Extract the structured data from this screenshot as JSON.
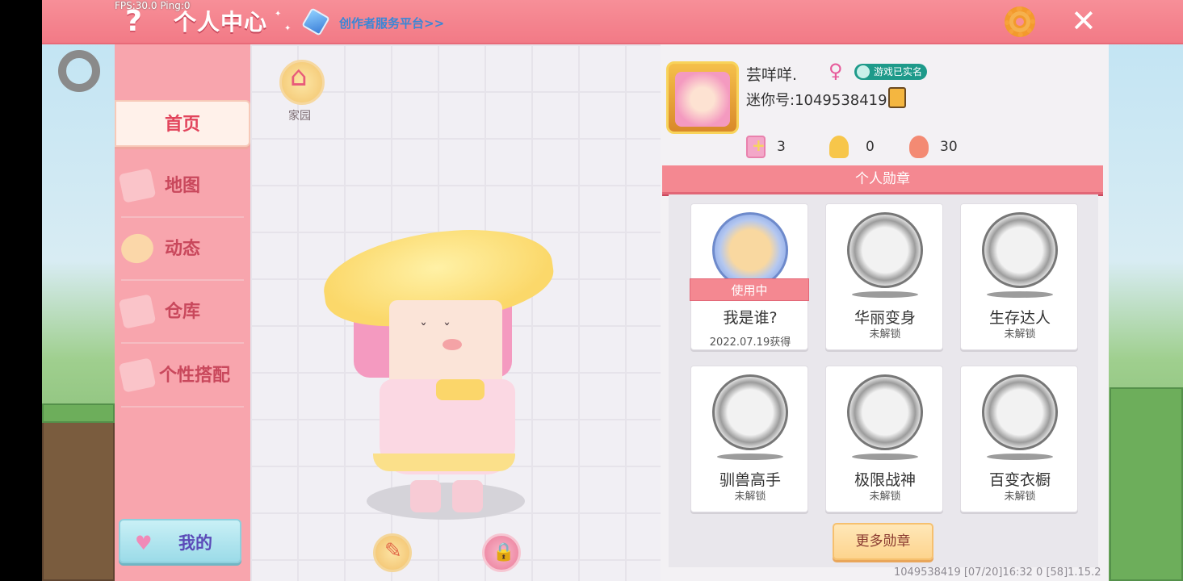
{
  "debug": {
    "fps_ping": "FPS:30.0  Ping:0"
  },
  "topbar": {
    "title": "个人中心",
    "creator_link": "创作者服务平台>>",
    "help_glyph": "?",
    "close_glyph": "✕"
  },
  "sidebar": {
    "items": [
      {
        "label": "首页",
        "active": true
      },
      {
        "label": "地图",
        "active": false
      },
      {
        "label": "动态",
        "active": false
      },
      {
        "label": "仓库",
        "active": false
      },
      {
        "label": "个性搭配",
        "active": false
      }
    ],
    "my_button": {
      "label": "我的",
      "icon": "heart-icon"
    }
  },
  "character": {
    "home_label": "家园"
  },
  "profile": {
    "nickname": "芸咩咩.",
    "gender_glyph": "♀",
    "verified_label": "游戏已实名",
    "mini_id": "迷你号:1049538419",
    "stats": [
      {
        "icon": "plus-flag-icon",
        "value": "3"
      },
      {
        "icon": "fan-icon",
        "value": "0"
      },
      {
        "icon": "flame-icon",
        "value": "30"
      }
    ]
  },
  "medals": {
    "header": "个人勋章",
    "items": [
      {
        "name": "我是谁?",
        "status": "2022.07.19获得",
        "in_use": "使用中",
        "icon": "letter-medal-icon",
        "unlocked": true
      },
      {
        "name": "华丽变身",
        "status": "未解锁",
        "icon": "dragon-medal-icon",
        "unlocked": false
      },
      {
        "name": "生存达人",
        "status": "未解锁",
        "icon": "campfire-medal-icon",
        "unlocked": false
      },
      {
        "name": "驯兽高手",
        "status": "未解锁",
        "icon": "horse-medal-icon",
        "unlocked": false
      },
      {
        "name": "极限战神",
        "status": "未解锁",
        "icon": "boss-medal-icon",
        "unlocked": false
      },
      {
        "name": "百变衣橱",
        "status": "未解锁",
        "icon": "wardrobe-medal-icon",
        "unlocked": false
      }
    ],
    "more_button": "更多勋章"
  },
  "footer": {
    "info": "1049538419   [07/20]16:32 0  [58]1.15.2"
  },
  "colors": {
    "topbar": "#f27a86",
    "sidebar": "#f8a5ad",
    "accent_text": "#c9485c",
    "creator_link": "#3a86d6",
    "verified": "#1e9a8a"
  }
}
